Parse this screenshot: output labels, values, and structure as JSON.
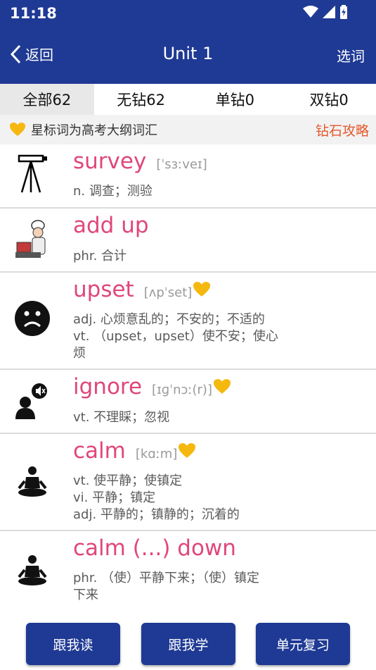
{
  "status": {
    "time": "11:18"
  },
  "header": {
    "back_label": "返回",
    "title": "Unit 1",
    "select_label": "选词"
  },
  "tabs": [
    {
      "label": "全部62",
      "active": true
    },
    {
      "label": "无钻62",
      "active": false
    },
    {
      "label": "单钻0",
      "active": false
    },
    {
      "label": "双钻0",
      "active": false
    }
  ],
  "notice": {
    "text": "星标词为高考大纲词汇",
    "link": "钻石攻略"
  },
  "words": [
    {
      "word": "survey",
      "phonetic": "[ˈsɜːveɪ]",
      "star": false,
      "defs": [
        "n. 调查；测验"
      ],
      "icon": "survey-tripod-icon"
    },
    {
      "word": "add up",
      "phonetic": "",
      "star": false,
      "defs": [
        "phr. 合计"
      ],
      "icon": "chef-adding-icon"
    },
    {
      "word": "upset",
      "phonetic": "[ʌpˈset]",
      "star": true,
      "defs": [
        "adj. 心烦意乱的；不安的；不适的",
        "vt. （upset，upset）使不安；使心",
        "烦"
      ],
      "icon": "sad-face-icon"
    },
    {
      "word": "ignore",
      "phonetic": "[ɪɡˈnɔː(r)]",
      "star": true,
      "defs": [
        "vt. 不理睬；忽视"
      ],
      "icon": "mute-person-icon"
    },
    {
      "word": "calm",
      "phonetic": "[kɑːm]",
      "star": true,
      "defs": [
        "vt. 使平静；使镇定",
        "vi. 平静；镇定",
        "adj. 平静的；镇静的；沉着的"
      ],
      "icon": "meditation-icon"
    },
    {
      "word": "calm (...) down",
      "phonetic": "",
      "star": false,
      "defs": [
        "phr. （使）平静下来；（使）镇定",
        "下来"
      ],
      "icon": "meditation-icon"
    }
  ],
  "buttons": {
    "read": "跟我读",
    "learn": "跟我学",
    "review": "单元复习"
  },
  "colors": {
    "primary": "#1f3a94",
    "word": "#e0467c",
    "star": "#f5b80f",
    "link": "#e3592c"
  }
}
